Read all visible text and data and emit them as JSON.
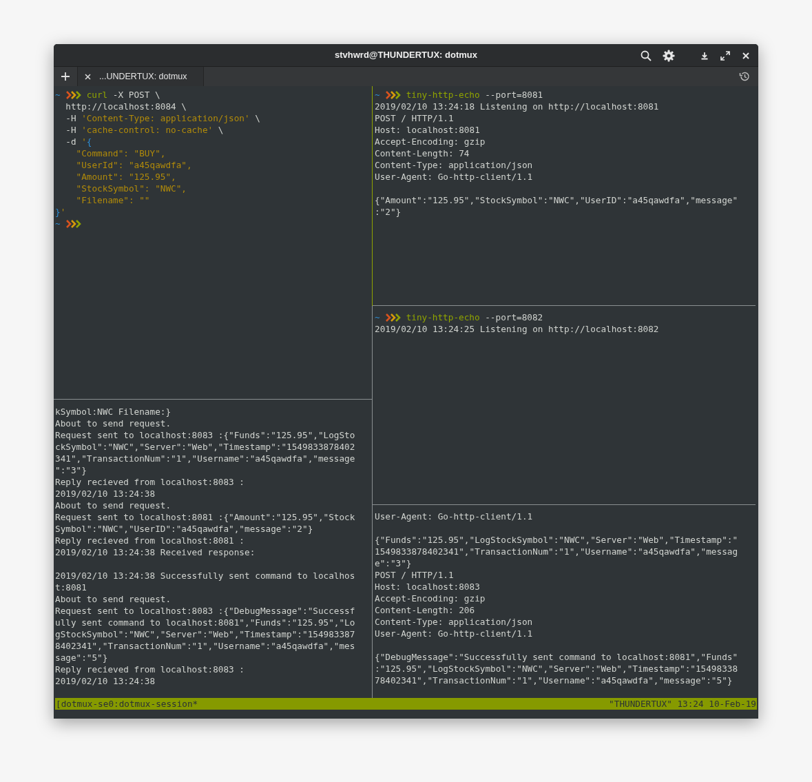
{
  "window": {
    "title": "stvhwrd@THUNDERTUX: dotmux"
  },
  "tabs": [
    {
      "label": "...UNDERTUX: dotmux",
      "selected": true
    }
  ],
  "panes": [
    {
      "active": false,
      "lines": [
        {
          "kind": "prompt",
          "cwd": "~",
          "parts": [
            {
              "text": "curl",
              "kind": "command"
            },
            {
              "text": " -X POST \\"
            }
          ]
        },
        {
          "kind": "code",
          "parts": [
            {
              "text": "  http://localhost:8084 \\"
            }
          ]
        },
        {
          "kind": "code",
          "parts": [
            {
              "text": "  -H "
            },
            {
              "text": "'Content-Type: application/json'",
              "kind": "string"
            },
            {
              "text": " \\"
            }
          ]
        },
        {
          "kind": "code",
          "parts": [
            {
              "text": "  -H "
            },
            {
              "text": "'cache-control: no-cache'",
              "kind": "string"
            },
            {
              "text": " \\"
            }
          ]
        },
        {
          "kind": "code",
          "parts": [
            {
              "text": "  -d "
            },
            {
              "text": "'",
              "kind": "string"
            },
            {
              "text": "{",
              "kind": "brace"
            }
          ]
        },
        {
          "kind": "code",
          "parts": [
            {
              "text": "    \"Command\": \"BUY\",",
              "kind": "string"
            }
          ]
        },
        {
          "kind": "code",
          "parts": [
            {
              "text": "    \"UserId\": \"a45qawdfa\",",
              "kind": "string"
            }
          ]
        },
        {
          "kind": "code",
          "parts": [
            {
              "text": "    \"Amount\": \"125.95\",",
              "kind": "string"
            }
          ]
        },
        {
          "kind": "code",
          "parts": [
            {
              "text": "    \"StockSymbol\": \"NWC\",",
              "kind": "string"
            }
          ]
        },
        {
          "kind": "code",
          "parts": [
            {
              "text": "    \"Filename\": \"\"",
              "kind": "string"
            }
          ]
        },
        {
          "kind": "code",
          "parts": [
            {
              "text": "}",
              "kind": "brace"
            },
            {
              "text": "'",
              "kind": "string"
            }
          ]
        },
        {
          "kind": "prompt",
          "cwd": "~"
        }
      ]
    },
    {
      "active": false,
      "lines": [
        {
          "kind": "text",
          "text": "kSymbol:NWC Filename:}"
        },
        {
          "kind": "text",
          "text": "About to send request."
        },
        {
          "kind": "text",
          "text": "Request sent to localhost:8083 :{\"Funds\":\"125.95\",\"LogSto"
        },
        {
          "kind": "text",
          "text": "ckSymbol\":\"NWC\",\"Server\":\"Web\",\"Timestamp\":\"1549833878402"
        },
        {
          "kind": "text",
          "text": "341\",\"TransactionNum\":\"1\",\"Username\":\"a45qawdfa\",\"message"
        },
        {
          "kind": "text",
          "text": "\":\"3\"}"
        },
        {
          "kind": "text",
          "text": "Reply recieved from localhost:8083 :"
        },
        {
          "kind": "text",
          "text": "2019/02/10 13:24:38"
        },
        {
          "kind": "text",
          "text": "About to send request."
        },
        {
          "kind": "text",
          "text": "Request sent to localhost:8081 :{\"Amount\":\"125.95\",\"Stock"
        },
        {
          "kind": "text",
          "text": "Symbol\":\"NWC\",\"UserID\":\"a45qawdfa\",\"message\":\"2\"}"
        },
        {
          "kind": "text",
          "text": "Reply recieved from localhost:8081 :"
        },
        {
          "kind": "text",
          "text": "2019/02/10 13:24:38 Received response:"
        },
        {
          "kind": "blank"
        },
        {
          "kind": "text",
          "text": "2019/02/10 13:24:38 Successfully sent command to localhos"
        },
        {
          "kind": "text",
          "text": "t:8081"
        },
        {
          "kind": "text",
          "text": "About to send request."
        },
        {
          "kind": "text",
          "text": "Request sent to localhost:8083 :{\"DebugMessage\":\"Successf"
        },
        {
          "kind": "text",
          "text": "ully sent command to localhost:8081\",\"Funds\":\"125.95\",\"Lo"
        },
        {
          "kind": "text",
          "text": "gStockSymbol\":\"NWC\",\"Server\":\"Web\",\"Timestamp\":\"154983387"
        },
        {
          "kind": "text",
          "text": "8402341\",\"TransactionNum\":\"1\",\"Username\":\"a45qawdfa\",\"mes"
        },
        {
          "kind": "text",
          "text": "sage\":\"5\"}"
        },
        {
          "kind": "text",
          "text": "Reply recieved from localhost:8083 :"
        },
        {
          "kind": "text",
          "text": "2019/02/10 13:24:38"
        }
      ]
    },
    {
      "active": true,
      "lines": [
        {
          "kind": "prompt",
          "cwd": "~",
          "parts": [
            {
              "text": "tiny-http-echo",
              "kind": "command"
            },
            {
              "text": " --port=8081"
            }
          ]
        },
        {
          "kind": "text",
          "text": "2019/02/10 13:24:18 Listening on http://localhost:8081"
        },
        {
          "kind": "text",
          "text": "POST / HTTP/1.1"
        },
        {
          "kind": "text",
          "text": "Host: localhost:8081"
        },
        {
          "kind": "text",
          "text": "Accept-Encoding: gzip"
        },
        {
          "kind": "text",
          "text": "Content-Length: 74"
        },
        {
          "kind": "text",
          "text": "Content-Type: application/json"
        },
        {
          "kind": "text",
          "text": "User-Agent: Go-http-client/1.1"
        },
        {
          "kind": "blank"
        },
        {
          "kind": "text",
          "text": "{\"Amount\":\"125.95\",\"StockSymbol\":\"NWC\",\"UserID\":\"a45qawdfa\",\"message\""
        },
        {
          "kind": "text",
          "text": ":\"2\"}"
        }
      ]
    },
    {
      "active": false,
      "lines": [
        {
          "kind": "prompt",
          "cwd": "~",
          "parts": [
            {
              "text": "tiny-http-echo",
              "kind": "command"
            },
            {
              "text": " --port=8082"
            }
          ]
        },
        {
          "kind": "text",
          "text": "2019/02/10 13:24:25 Listening on http://localhost:8082"
        }
      ]
    },
    {
      "active": false,
      "lines": [
        {
          "kind": "text",
          "text": "User-Agent: Go-http-client/1.1"
        },
        {
          "kind": "blank"
        },
        {
          "kind": "text",
          "text": "{\"Funds\":\"125.95\",\"LogStockSymbol\":\"NWC\",\"Server\":\"Web\",\"Timestamp\":\""
        },
        {
          "kind": "text",
          "text": "1549833878402341\",\"TransactionNum\":\"1\",\"Username\":\"a45qawdfa\",\"messag"
        },
        {
          "kind": "text",
          "text": "e\":\"3\"}"
        },
        {
          "kind": "text",
          "text": "POST / HTTP/1.1"
        },
        {
          "kind": "text",
          "text": "Host: localhost:8083"
        },
        {
          "kind": "text",
          "text": "Accept-Encoding: gzip"
        },
        {
          "kind": "text",
          "text": "Content-Length: 206"
        },
        {
          "kind": "text",
          "text": "Content-Type: application/json"
        },
        {
          "kind": "text",
          "text": "User-Agent: Go-http-client/1.1"
        },
        {
          "kind": "blank"
        },
        {
          "kind": "text",
          "text": "{\"DebugMessage\":\"Successfully sent command to localhost:8081\",\"Funds\""
        },
        {
          "kind": "text",
          "text": ":\"125.95\",\"LogStockSymbol\":\"NWC\",\"Server\":\"Web\",\"Timestamp\":\"15498338"
        },
        {
          "kind": "text",
          "text": "78402341\",\"TransactionNum\":\"1\",\"Username\":\"a45qawdfa\",\"message\":\"5\"}"
        }
      ]
    }
  ],
  "status_bar": {
    "left": "[dotmux-se0:dotmux-session*",
    "right": "\"THUNDERTUX\" 13:24 10-Feb-19"
  }
}
